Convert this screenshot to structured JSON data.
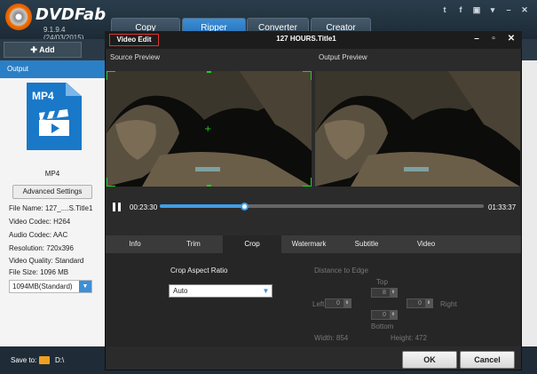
{
  "app": {
    "name": "DVDFab",
    "version": "9.1.9.4 (24/03/2015)",
    "tabs": [
      "Copy",
      "Ripper",
      "Converter",
      "Creator"
    ],
    "active_tab": "Ripper",
    "title_icons": [
      "twitter-icon",
      "facebook-icon",
      "youtube-icon",
      "dropdown-icon",
      "minimize-icon",
      "close-icon"
    ]
  },
  "toolbar": {
    "add_label": "Add"
  },
  "left_panel": {
    "output_label": "Output",
    "format_icon_text": "MP4",
    "format_label": "MP4",
    "advanced_button": "Advanced Settings",
    "info": [
      "File Name: 127_....S.Title1",
      "Video Codec: H264",
      "Audio Codec: AAC",
      "Resolution: 720x396",
      "Video Quality: Standard",
      "File Size: 1096 MB"
    ],
    "size_option": "1094MB(Standard)"
  },
  "status": {
    "save_to_label": "Save to:",
    "path": "D:\\"
  },
  "dialog": {
    "label": "Video Edit",
    "title": "127  HOURS.Title1",
    "source_preview": "Source Preview",
    "output_preview": "Output Preview",
    "current_time": "00:23:30",
    "total_time": "01:33:37",
    "progress": 0.26,
    "tabs": [
      "Info",
      "Trim",
      "Crop",
      "Watermark",
      "Subtitle",
      "Video"
    ],
    "active_tab": "Crop",
    "crop": {
      "aspect_label": "Crop Aspect Ratio",
      "aspect_value": "Auto",
      "distance_label": "Distance to Edge",
      "top_label": "Top",
      "top_value": "8",
      "left_label": "Left",
      "left_value": "0",
      "right_label": "Right",
      "right_value": "0",
      "bottom_label": "Bottom",
      "bottom_value": "0",
      "width_text": "Width: 854",
      "height_text": "Height: 472"
    },
    "ok_label": "OK",
    "cancel_label": "Cancel"
  },
  "colors": {
    "accent": "#2b7fc6",
    "crop_handles": "#20d020",
    "dialog_bg": "#2b2b2b",
    "highlight_box": "#e03030"
  }
}
